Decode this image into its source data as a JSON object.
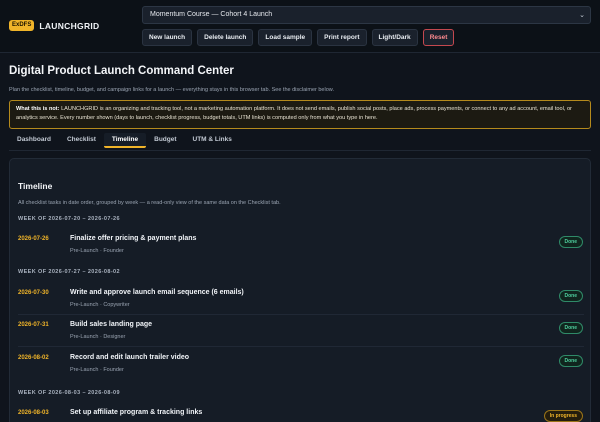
{
  "brand": {
    "badge": "ExDFS",
    "name": "LAUNCHGRID"
  },
  "project_select": {
    "value": "Momentum Course — Cohort 4 Launch"
  },
  "toolbar": {
    "new_launch": "New launch",
    "delete_launch": "Delete launch",
    "load_sample": "Load sample",
    "print_report": "Print report",
    "light_dark": "Light/Dark",
    "reset": "Reset"
  },
  "page": {
    "title": "Digital Product Launch Command Center",
    "subtitle": "Plan the checklist, timeline, budget, and campaign links for a launch — everything stays in this browser tab. See the disclaimer below."
  },
  "disclaimer": {
    "label": "What this is not:",
    "text": " LAUNCHGRID is an organizing and tracking tool, not a marketing automation platform. It does not send emails, publish social posts, place ads, process payments, or connect to any ad account, email tool, or analytics service. Every number shown (days to launch, checklist progress, budget totals, UTM links) is computed only from what you type in here."
  },
  "tabs": [
    "Dashboard",
    "Checklist",
    "Timeline",
    "Budget",
    "UTM & Links"
  ],
  "active_tab": "Timeline",
  "timeline": {
    "title": "Timeline",
    "subtitle": "All checklist tasks in date order, grouped by week — a read-only view of the same data on the Checklist tab.",
    "weeks": [
      {
        "label": "WEEK OF 2026-07-20 – 2026-07-26",
        "tasks": [
          {
            "date": "2026-07-26",
            "title": "Finalize offer pricing & payment plans",
            "meta": "Pre-Launch · Founder",
            "status": "Done"
          }
        ]
      },
      {
        "label": "WEEK OF 2026-07-27 – 2026-08-02",
        "tasks": [
          {
            "date": "2026-07-30",
            "title": "Write and approve launch email sequence (6 emails)",
            "meta": "Pre-Launch · Copywriter",
            "status": "Done"
          },
          {
            "date": "2026-07-31",
            "title": "Build sales landing page",
            "meta": "Pre-Launch · Designer",
            "status": "Done"
          },
          {
            "date": "2026-08-02",
            "title": "Record and edit launch trailer video",
            "meta": "Pre-Launch · Founder",
            "status": "Done"
          }
        ]
      },
      {
        "label": "WEEK OF 2026-08-03 – 2026-08-09",
        "tasks": [
          {
            "date": "2026-08-03",
            "title": "Set up affiliate program & tracking links",
            "meta": "",
            "status": "In progress"
          }
        ]
      }
    ]
  },
  "colors": {
    "accent": "#f0b429",
    "done": "#4fd1a0",
    "danger": "#ff8a8f",
    "background": "#0f141c"
  }
}
